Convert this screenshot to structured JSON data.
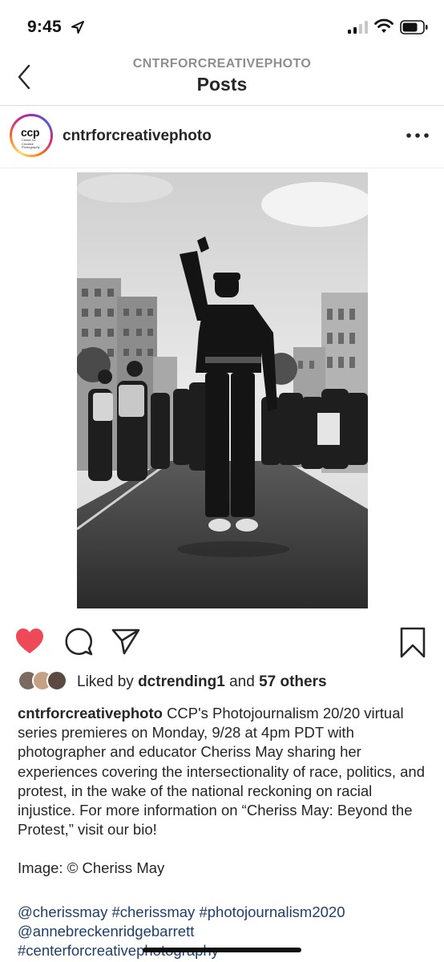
{
  "status_bar": {
    "time": "9:45",
    "icons": [
      "location-arrow-icon",
      "signal-icon",
      "wifi-icon",
      "battery-icon"
    ]
  },
  "nav": {
    "account": "CNTRFORCREATIVEPHOTO",
    "title": "Posts",
    "back_icon": "chevron-left-icon"
  },
  "post": {
    "avatar_logo": "ccp",
    "avatar_logo_subtext": "Center for Creative Photography",
    "username": "cntrforcreativephoto",
    "more_icon": "more-horizontal-icon",
    "liked": true,
    "likes": {
      "prefix": "Liked by",
      "first_user": "dctrending1",
      "conjunction": "and",
      "others": "57 others"
    },
    "caption": {
      "author": "cntrforcreativephoto",
      "text": "CCP's Photojournalism 20/20 virtual series premieres on Monday, 9/28 at 4pm PDT with photographer and educator Cheriss May sharing her experiences covering the intersectionality of race, politics, and protest, in the wake of the national reckoning on racial injustice. For more information on “Cheriss May: Beyond the Protest,” visit our bio!"
    },
    "credit": "Image: © Cheriss May",
    "tags": [
      "@cherissmay",
      "#cherissmay",
      "#photojournalism2020",
      "@annebreckenridgebarrett",
      "#centerforcreativephotography"
    ]
  },
  "colors": {
    "heart": "#ed4956",
    "link": "#1f3f6b",
    "text": "#262626",
    "muted": "#8e8e8e"
  }
}
